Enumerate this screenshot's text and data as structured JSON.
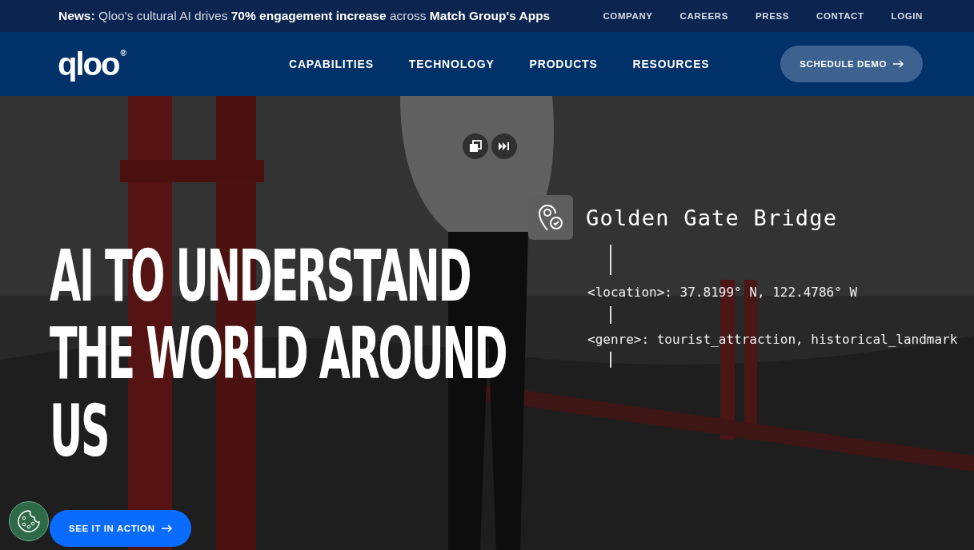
{
  "news_bar": {
    "text": "**News:** Qloo's cultural AI drives **70% engagement increase** across **Match Group's Apps**",
    "links": [
      "COMPANY",
      "CAREERS",
      "PRESS",
      "CONTACT",
      "LOGIN"
    ]
  },
  "header": {
    "logo": "qloo",
    "logo_mark": "®",
    "nav": [
      "CAPABILITIES",
      "TECHNOLOGY",
      "PRODUCTS",
      "RESOURCES"
    ],
    "cta": "SCHEDULE DEMO"
  },
  "hero": {
    "headline": "AI TO UNDERSTAND THE WORLD AROUND US",
    "button": "SEE IT IN ACTION",
    "entity": {
      "name": "Golden Gate Bridge",
      "attributes": [
        "<location>: 37.8199° N, 122.4786° W",
        "<genre>: tourist_attraction, historical_landmark"
      ]
    }
  }
}
